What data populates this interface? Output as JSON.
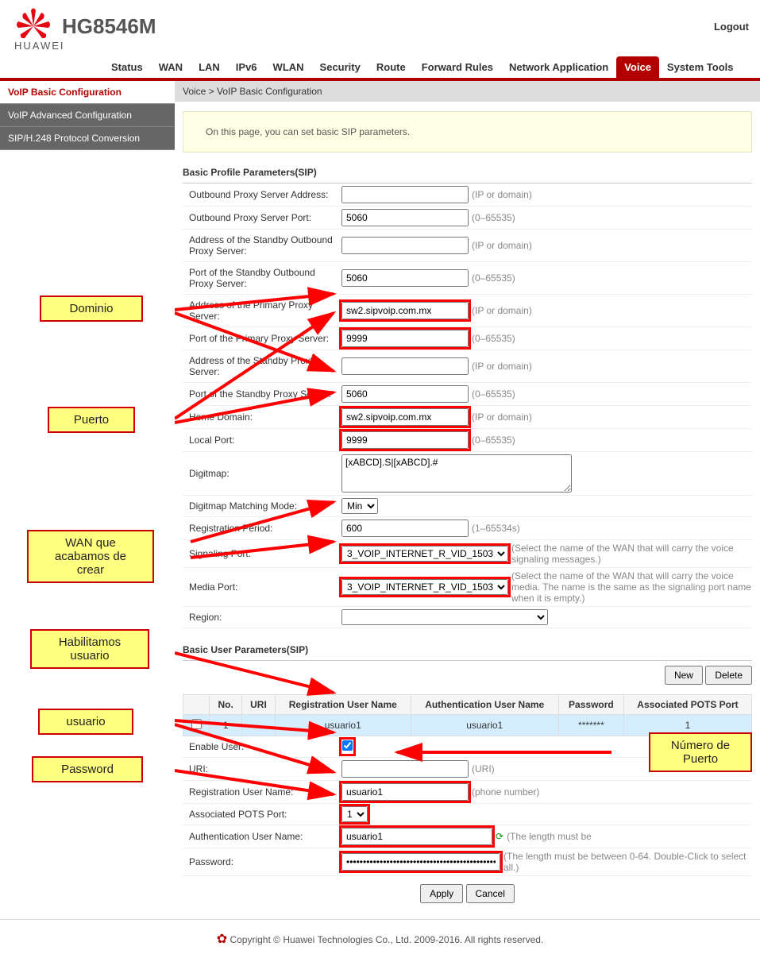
{
  "header": {
    "model": "HG8546M",
    "brand": "HUAWEI",
    "logout": "Logout"
  },
  "tabs": [
    "Status",
    "WAN",
    "LAN",
    "IPv6",
    "WLAN",
    "Security",
    "Route",
    "Forward Rules",
    "Network Application",
    "Voice",
    "System Tools"
  ],
  "tabs_active_index": 9,
  "sidebar": {
    "items": [
      "VoIP Basic Configuration",
      "VoIP Advanced Configuration",
      "SIP/H.248 Protocol Conversion"
    ],
    "active_index": 0
  },
  "breadcrumb": "Voice > VoIP Basic Configuration",
  "notice": "On this page, you can set basic SIP parameters.",
  "profile": {
    "title": "Basic Profile Parameters(SIP)",
    "outbound_addr_label": "Outbound Proxy Server Address:",
    "outbound_addr": "",
    "outbound_addr_hint": "(IP or domain)",
    "outbound_port_label": "Outbound Proxy Server Port:",
    "outbound_port": "5060",
    "outbound_port_hint": "(0–65535)",
    "standby_outbound_addr_label": "Address of the Standby Outbound Proxy Server:",
    "standby_outbound_addr": "",
    "standby_outbound_addr_hint": "(IP or domain)",
    "standby_outbound_port_label": "Port of the Standby Outbound Proxy Server:",
    "standby_outbound_port": "5060",
    "standby_outbound_port_hint": "(0–65535)",
    "primary_addr_label": "Address of the Primary Proxy Server:",
    "primary_addr": "sw2.sipvoip.com.mx",
    "primary_addr_hint": "(IP or domain)",
    "primary_port_label": "Port of the Primary Proxy Server:",
    "primary_port": "9999",
    "primary_port_hint": "(0–65535)",
    "standby_proxy_addr_label": "Address of the Standby Proxy Server:",
    "standby_proxy_addr": "",
    "standby_proxy_addr_hint": "(IP or domain)",
    "standby_proxy_port_label": "Port of the Standby Proxy Server:",
    "standby_proxy_port": "5060",
    "standby_proxy_port_hint": "(0–65535)",
    "home_domain_label": "Home Domain:",
    "home_domain": "sw2.sipvoip.com.mx",
    "home_domain_hint": "(IP or domain)",
    "local_port_label": "Local Port:",
    "local_port": "9999",
    "local_port_hint": "(0–65535)",
    "digitmap_label": "Digitmap:",
    "digitmap": "[xABCD].S|[xABCD].#",
    "digitmap_mode_label": "Digitmap Matching Mode:",
    "digitmap_mode": "Min",
    "reg_period_label": "Registration Period:",
    "reg_period": "600",
    "reg_period_hint": "(1–65534s)",
    "signaling_label": "Signaling Port:",
    "signaling_sel": "3_VOIP_INTERNET_R_VID_1503",
    "signaling_hint": "(Select the name of the WAN that will carry the voice signaling messages.)",
    "media_label": "Media Port:",
    "media_sel": "3_VOIP_INTERNET_R_VID_1503",
    "media_hint": "(Select the name of the WAN that will carry the voice media. The name is the same as the signaling port name when it is empty.)",
    "region_label": "Region:",
    "region_sel": ""
  },
  "users": {
    "title": "Basic User Parameters(SIP)",
    "new_btn": "New",
    "delete_btn": "Delete",
    "cols": [
      "",
      "No.",
      "URI",
      "Registration User Name",
      "Authentication User Name",
      "Password",
      "Associated POTS Port"
    ],
    "row": {
      "no": "1",
      "uri": "--",
      "reg": "usuario1",
      "auth": "usuario1",
      "pwd": "*******",
      "port": "1"
    },
    "enable_label": "Enable User:",
    "enable_checked": true,
    "uri_label": "URI:",
    "uri_val": "",
    "uri_hint": "(URI)",
    "reg_label": "Registration User Name:",
    "reg_val": "usuario1",
    "reg_hint": "(phone number)",
    "pots_label": "Associated POTS Port:",
    "pots_val": "1",
    "auth_label": "Authentication User Name:",
    "auth_val": "usuario1",
    "auth_hint": "(The length must be",
    "pwd_label": "Password:",
    "pwd_val": "••••••••••••••••••••••••••••••••••••••••••••••••••••",
    "pwd_hint": "(The length must be between 0-64. Double-Click to select all.)",
    "apply": "Apply",
    "cancel": "Cancel"
  },
  "footer": "Copyright © Huawei Technologies Co., Ltd. 2009-2016. All rights reserved.",
  "callouts": {
    "dominio": "Dominio",
    "puerto": "Puerto",
    "wan": "WAN que\nacabamos de\ncrear",
    "habilitamos": "Habilitamos\nusuario",
    "usuario": "usuario",
    "password": "Password",
    "num_puerto": "Número de\nPuerto"
  }
}
